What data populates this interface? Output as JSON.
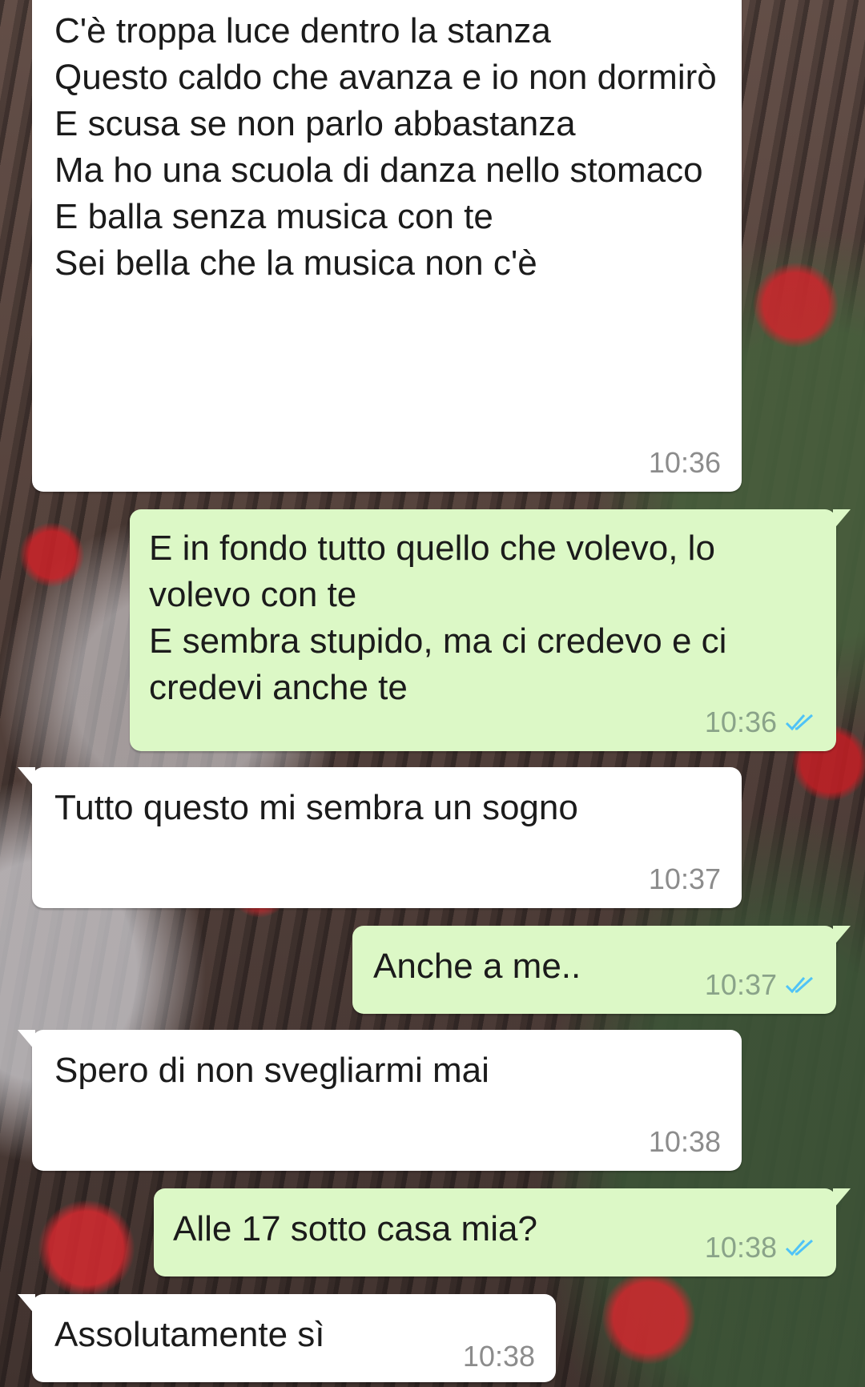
{
  "colors": {
    "incoming_bubble": "#ffffff",
    "outgoing_bubble": "#dcf8c6",
    "read_ticks": "#4fc3f7",
    "timestamp": "#8c8c8c"
  },
  "messages": [
    {
      "direction": "incoming",
      "text": "C'è troppa luce dentro la stanza\nQuesto caldo che avanza e io non dormirò\nE scusa se non parlo abbastanza\nMa ho una scuola di danza nello stomaco\nE balla senza musica con te\nSei bella che la musica non c'è",
      "time": "10:36"
    },
    {
      "direction": "outgoing",
      "text": "E in fondo tutto quello che volevo, lo volevo con te\nE sembra stupido, ma ci credevo e ci credevi anche te",
      "time": "10:36",
      "status": "read-ticks-icon"
    },
    {
      "direction": "incoming",
      "text": "Tutto questo mi sembra un sogno",
      "time": "10:37"
    },
    {
      "direction": "outgoing",
      "text": "Anche a me..",
      "time": "10:37",
      "status": "read-ticks-icon"
    },
    {
      "direction": "incoming",
      "text": "Spero di non svegliarmi mai",
      "time": "10:38"
    },
    {
      "direction": "outgoing",
      "text": "Alle 17 sotto casa mia?",
      "time": "10:38",
      "status": "read-ticks-icon"
    },
    {
      "direction": "incoming",
      "text": "Assolutamente sì",
      "time": "10:38"
    }
  ]
}
